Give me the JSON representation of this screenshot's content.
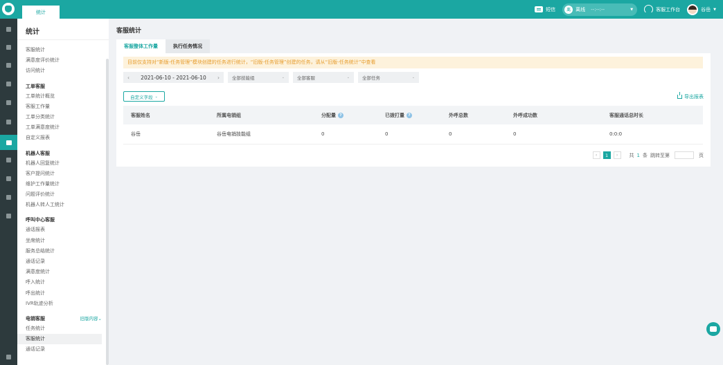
{
  "topbar": {
    "tab_label": "统计",
    "sms_label": "短信",
    "status_dot": "离",
    "status_label": "离线",
    "status_time": "--:--:--",
    "workbench_label": "客服工作台",
    "username": "谷岳"
  },
  "rail_icons": [
    "home-icon",
    "grid-icon",
    "trash-icon",
    "phone-icon",
    "chat-icon",
    "user-icon",
    "stats-icon",
    "search-icon",
    "gear-icon",
    "card-icon",
    "profile-icon",
    "bell-icon"
  ],
  "sidebar": {
    "title": "统计",
    "groups": [
      {
        "title": "",
        "items": [
          "客服统计",
          "满意度评价统计",
          "访问统计"
        ]
      },
      {
        "title": "工单客服",
        "items": [
          "工单统计概览",
          "客服工作量",
          "工单分类统计",
          "工单满意度统计",
          "自定义报表"
        ]
      },
      {
        "title": "机器人客服",
        "items": [
          "机器人回复统计",
          "客户提问统计",
          "维护工作量统计",
          "问题评价统计",
          "机器人转人工统计"
        ]
      },
      {
        "title": "呼叫中心客服",
        "items": [
          "通话报表",
          "坐席统计",
          "服务总结统计",
          "通话记录",
          "满意度统计",
          "呼入统计",
          "呼出统计",
          "IVR轨迹分析"
        ]
      },
      {
        "title": "电销客服",
        "old_label": "旧版内容",
        "items": [
          "任务统计",
          "客服统计",
          "通话记录"
        ],
        "active_item": "客服统计"
      }
    ]
  },
  "main": {
    "title": "客服统计",
    "tabs": [
      "客服整体工作量",
      "执行任务情况"
    ],
    "active_tab": "客服整体工作量",
    "notice": "目前仅支持对“新版-任务管理”模块创建的任务进行统计，“旧版-任务管理”创建的任务，请从“旧版-任务统计”中查看",
    "date_range": "2021-06-10 - 2021-06-10",
    "filters": [
      "全部技能组",
      "全部客服",
      "全部任务"
    ],
    "custom_fields_label": "自定义字段",
    "export_label": "导出报表",
    "table": {
      "columns": [
        "客服姓名",
        "所属电销组",
        "分配量",
        "已拨打量",
        "外呼总数",
        "外呼成功数",
        "客服通话总时长"
      ],
      "rows": [
        [
          "谷岳",
          "谷岳电销技能组",
          "0",
          "0",
          "0",
          "0",
          "0:0:0"
        ]
      ]
    },
    "pager": {
      "current_page": "1",
      "total_prefix": "共",
      "total_count": "1",
      "total_suffix": "条",
      "jump_label": "跳转至第",
      "page_suffix": "页"
    }
  },
  "colors": {
    "accent": "#1ba7a2",
    "notice_bg": "#fdf2dc",
    "notice_text": "#e69c2c",
    "rail_bg": "#2d3a3d"
  }
}
